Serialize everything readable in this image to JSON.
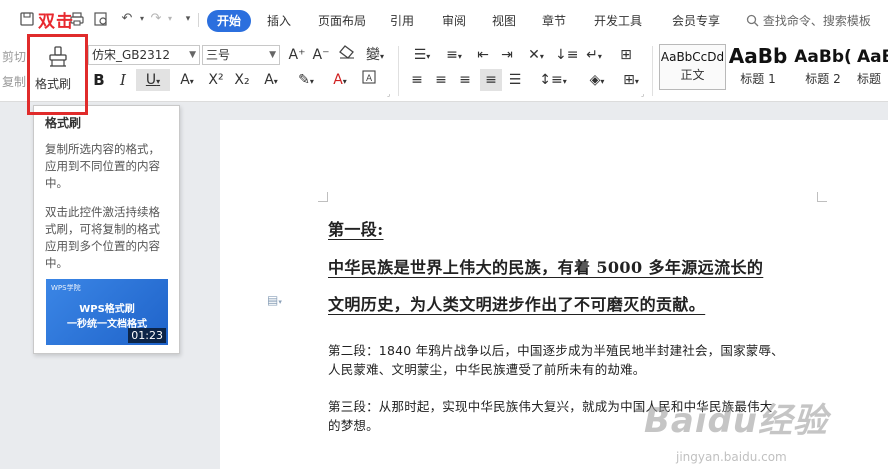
{
  "annotation": {
    "double_click_label": "双击"
  },
  "menu": {
    "tabs": [
      "开始",
      "插入",
      "页面布局",
      "引用",
      "审阅",
      "视图",
      "章节",
      "开发工具",
      "会员专享"
    ],
    "active_tab": "开始",
    "search_placeholder": "查找命令、搜索模板"
  },
  "ribbon": {
    "cut_label": "剪切",
    "copy_label": "复制",
    "format_painter_label": "格式刷",
    "font_name": "仿宋_GB2312",
    "font_size": "三号",
    "styles": [
      {
        "preview": "AaBbCcDd",
        "name": "正文"
      },
      {
        "preview": "AaBb",
        "name": "标题 1"
      },
      {
        "preview": "AaBb(",
        "name": "标题 2"
      },
      {
        "preview": "AaB",
        "name": "标题"
      }
    ]
  },
  "tooltip": {
    "title": "格式刷",
    "body1": "复制所选内容的格式，应用到不同位置的内容中。",
    "body2": "双击此控件激活持续格式刷，可将复制的格式应用到多个位置的内容中。",
    "video_brand": "WPS学院",
    "video_line1": "WPS格式刷",
    "video_line2": "一秒统一文档格式",
    "video_duration": "01:23"
  },
  "document": {
    "para1_line1": "第一段:",
    "para1_line2": "中华民族是世界上伟大的民族，有着 5000 多年源远流长的",
    "para1_line3": "文明历史，为人类文明进步作出了不可磨灭的贡献。",
    "para2_line1": "第二段：1840 年鸦片战争以后，中国逐步成为半殖民地半封建社会，国家蒙辱、",
    "para2_line2": "人民蒙难、文明蒙尘，中华民族遭受了前所未有的劫难。",
    "para3_line1": "第三段：从那时起，实现中华民族伟大复兴，就成为中国人民和中华民族最伟大",
    "para3_line2": "的梦想。"
  },
  "watermark": {
    "logo": "Baidu经验",
    "url": "jingyan.baidu.com"
  }
}
